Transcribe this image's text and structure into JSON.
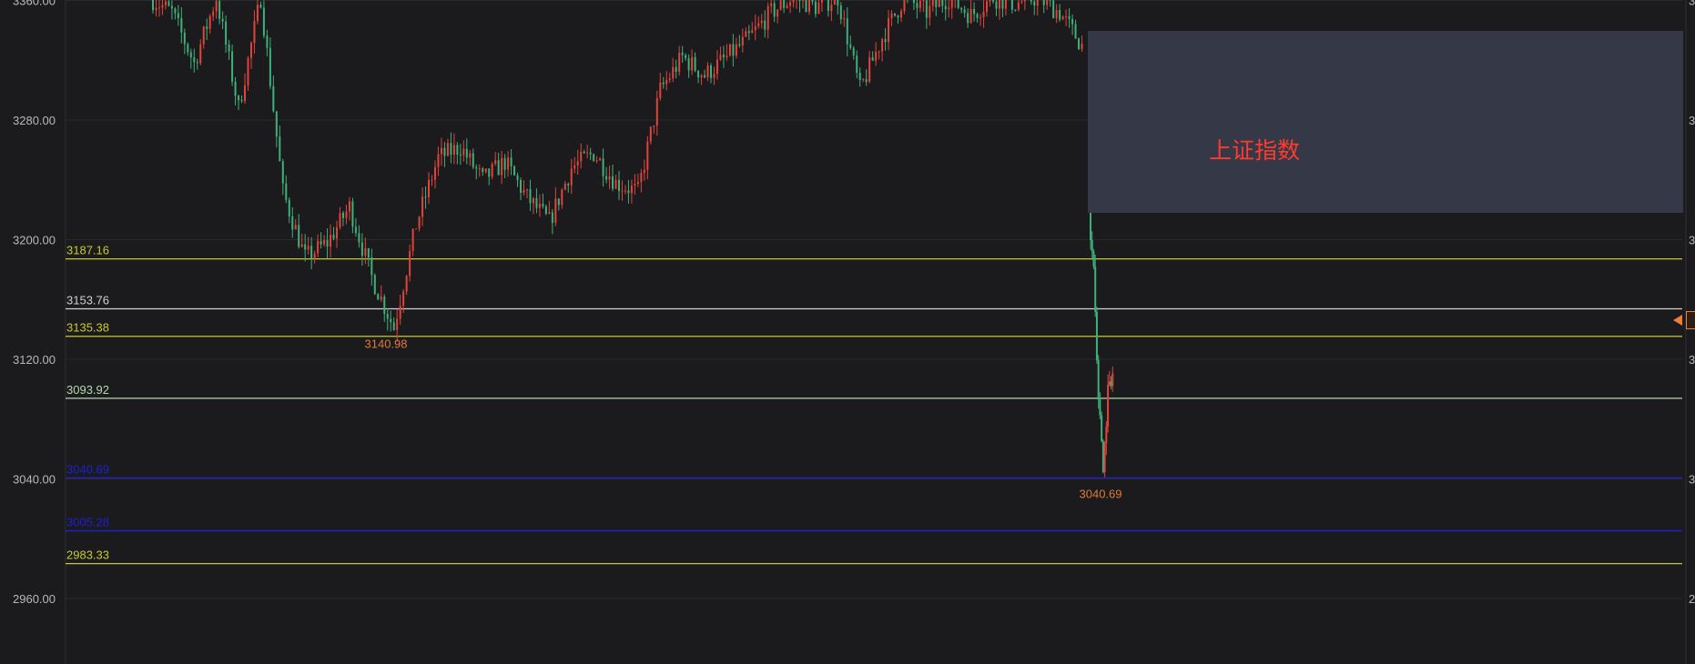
{
  "chart_data": {
    "type": "candlestick",
    "title": "",
    "y_axis": {
      "ticks": [
        "2960.00",
        "3040.00",
        "3120.00",
        "3200.00",
        "3280.00",
        "3360.00"
      ],
      "ylim": [
        2920,
        3365
      ]
    },
    "levels": [
      {
        "label": "3187.16",
        "value": 3187.16,
        "color": "#c8c832"
      },
      {
        "label": "3153.76",
        "value": 3153.76,
        "color": "#d0d0d0"
      },
      {
        "label": "3135.38",
        "value": 3135.38,
        "color": "#c8c832"
      },
      {
        "label": "3093.92",
        "value": 3093.92,
        "color": "#b6d6b0"
      },
      {
        "label": "3040.69",
        "value": 3040.69,
        "color": "#1f1fd6"
      },
      {
        "label": "3005.28",
        "value": 3005.28,
        "color": "#1f1fd6"
      },
      {
        "label": "2983.33",
        "value": 2983.33,
        "color": "#c8c832"
      }
    ],
    "annotations": [
      {
        "label": "3140.98",
        "value": 3140.98,
        "color": "#e0793a"
      },
      {
        "label": "3040.69",
        "value": 3040.69,
        "color": "#e0793a"
      }
    ],
    "up_color": "#e0443a",
    "down_color": "#3fb07a",
    "segments": [
      [
        3362,
        3352,
        3318,
        3362,
        3288,
        3362,
        3232,
        3188,
        3198,
        3222,
        3175,
        3140.98,
        3210,
        3255,
        3262,
        3240,
        3252,
        3228,
        3212,
        3248,
        3258,
        3238,
        3232,
        3300,
        3322,
        3310,
        3322,
        3335,
        3352,
        3362,
        3356,
        3362,
        3300,
        3335,
        3362,
        3352,
        3362,
        3350,
        3362,
        3358,
        3362,
        3352,
        3330
      ],
      [
        3220,
        3180,
        3093.92,
        3040.69,
        3100,
        3110
      ]
    ]
  },
  "overlay": {
    "label": "上证指数"
  },
  "colors": {
    "background": "#1b1b1d",
    "grid": "#2a2a2d",
    "overlay": "#353846",
    "overlay_text": "#ff3b30"
  }
}
